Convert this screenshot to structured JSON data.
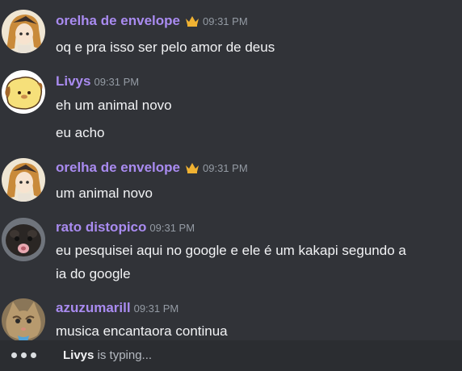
{
  "messages": [
    {
      "author": "orelha de envelope",
      "crown": true,
      "time": "09:31 PM",
      "avatar": "anime-character-avatar",
      "lines": [
        "oq e pra isso ser pelo amor de deus"
      ]
    },
    {
      "author": "Livys",
      "crown": false,
      "time": "09:31 PM",
      "avatar": "pompompurin-avatar",
      "lines": [
        "eh um animal novo",
        "eu acho"
      ]
    },
    {
      "author": "orelha de envelope",
      "crown": true,
      "time": "09:31 PM",
      "avatar": "anime-character-avatar",
      "lines": [
        "um animal novo"
      ]
    },
    {
      "author": "rato distopico",
      "crown": false,
      "time": "09:31 PM",
      "avatar": "animal-face-avatar",
      "lines": [
        "eu pesquisei aqui no google e ele é um kakapi segundo a",
        "ia do google"
      ]
    },
    {
      "author": "azuzumarill",
      "crown": false,
      "time": "09:31 PM",
      "avatar": "cat-avatar",
      "lines": [
        "musica encantaora continua"
      ]
    }
  ],
  "typing": {
    "user": "Livys",
    "text": " is typing..."
  },
  "colors": {
    "background": "#313338",
    "username": "#a98bf0",
    "crown": "#f0b232",
    "timestamp": "#949ba4",
    "typing_bar": "#2b2d31"
  }
}
